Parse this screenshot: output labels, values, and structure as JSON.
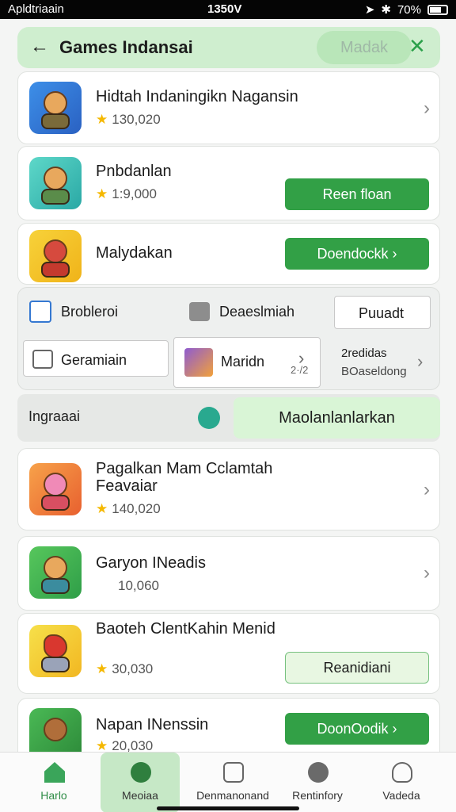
{
  "status": {
    "app": "Apldtriaain",
    "time": "1350V",
    "battery": "70%"
  },
  "header": {
    "title": "Games Indansai",
    "badge": "Madak"
  },
  "games": [
    {
      "name": "Hidtah Indaningikn Nagansin",
      "rating": "130,020"
    },
    {
      "name": "Pnbdanlan",
      "rating": "1:9,000",
      "button": "Reen floan"
    },
    {
      "name": "Malydakan",
      "button": "Doendockk"
    }
  ],
  "panel": {
    "row1_a": "Brobleroi",
    "row1_b": "Deaeslmiah",
    "row1_btn": "Puuadt",
    "row2_a": "Geramiain",
    "row2_b": "Maridn",
    "row2_c_top": "2redidas",
    "row2_c_bottom": "BOaseldong",
    "row2_c_mid": "2·/2"
  },
  "feature": {
    "label": "Ingraaai",
    "button": "Maolanlanlarkan"
  },
  "games2": [
    {
      "name": "Pagalkan Mam Cclamtah Feavaiar",
      "rating": "140,020"
    },
    {
      "name": "Garyon INeadis",
      "rating": "10,060"
    },
    {
      "name": "Baoteh ClentKahin Menid",
      "rating": "30,030",
      "button": "Reanidiani"
    },
    {
      "name": "Napan INenssin",
      "rating": "20,030",
      "button": "DoonOodik"
    }
  ],
  "nav": [
    {
      "label": "Harlo"
    },
    {
      "label": "Meoiaa"
    },
    {
      "label": "Denmanonand"
    },
    {
      "label": "Rentinfory"
    },
    {
      "label": "Vadeda"
    }
  ],
  "colors": {
    "accent": "#32a046",
    "header_bg": "#cfeecf",
    "star": "#f5b800"
  }
}
